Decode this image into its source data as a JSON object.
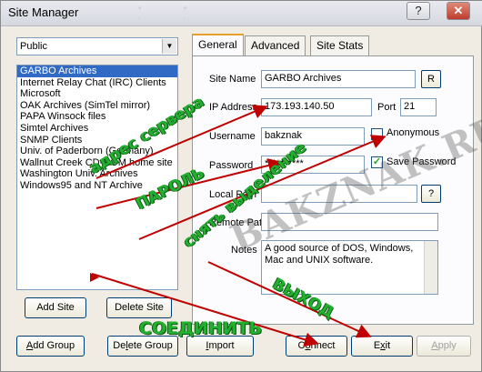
{
  "window": {
    "title": "Site Manager",
    "ghost": [
      "+",
      "+ ",
      "·",
      "·"
    ]
  },
  "titlebar_buttons": {
    "help": "?",
    "close": "✕"
  },
  "site_filter": {
    "value": "Public",
    "drop": "▼"
  },
  "sites": [
    "GARBO Archives",
    "Internet Relay Chat (IRC) Clients",
    "Microsoft",
    "OAK Archives (SimTel mirror)",
    "PAPA Winsock files",
    "Simtel Archives",
    "SNMP Clients",
    "Univ. of Paderborn (Germany)",
    "Wallnut Creek CD-ROM home site",
    "Washington Univ. Archives",
    "Windows95 and NT Archive"
  ],
  "tabs": {
    "general": "General",
    "advanced": "Advanced",
    "stats": "Site Stats"
  },
  "form": {
    "site_name_label": "Site Name",
    "site_name": "GARBO Archives",
    "rename_btn": "R",
    "ip_label": "IP Address",
    "ip": "173.193.140.50",
    "port_label": "Port",
    "port": "21",
    "username_label": "Username",
    "username": "bakznak",
    "anonymous_label": "Anonymous",
    "password_label": "Password",
    "password": "**********",
    "save_password_label": "Save Password",
    "save_password_mark": "✓",
    "local_path_label": "Local Path",
    "local_path_btn": "?",
    "remote_path_label": "Remote Path",
    "notes_label": "Notes",
    "notes": "A good source of DOS, Windows, Mac and UNIX software."
  },
  "buttons": {
    "add_site": "Add Site",
    "delete_site": "Delete Site",
    "add_group_u": "A",
    "add_group_rest": "dd Group",
    "delete_group_pre": "De",
    "delete_group_u": "l",
    "delete_group_rest": "ete Group",
    "import_u": "I",
    "import_rest": "mport",
    "connect_pre": "C",
    "connect_u": "o",
    "connect_rest": "nnect",
    "exit_pre": "E",
    "exit_u": "x",
    "exit_rest": "it",
    "apply_u": "A",
    "apply_rest": "pply"
  },
  "annotations": {
    "server_address": "адрес сервера",
    "password": "ПАРОЛЬ",
    "remove_selection": "снять выделение",
    "exit": "ВЫХОД",
    "connect": "СОЕДИНИТЬ"
  },
  "watermark": "BAKZNAK.RU",
  "colors": {
    "annotation": "#22b030",
    "arrow": "#c00000",
    "selection": "#316ac5"
  }
}
